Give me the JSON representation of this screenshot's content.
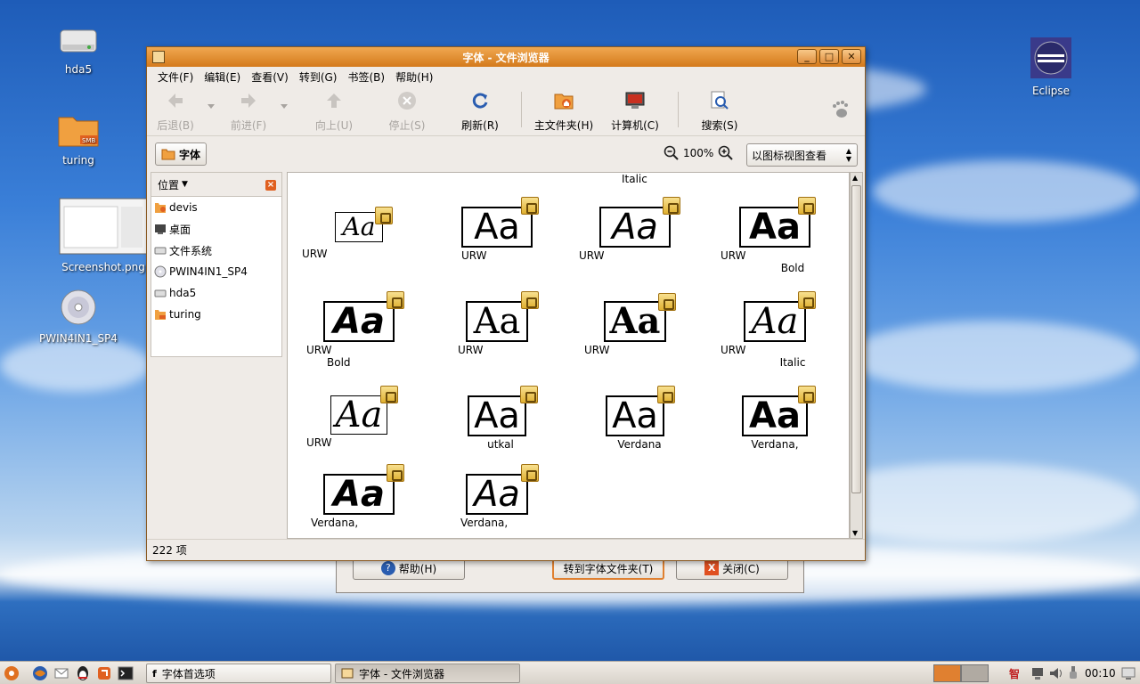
{
  "desktop": {
    "icons": [
      {
        "label": "hda5"
      },
      {
        "label": "turing"
      },
      {
        "label": "Screenshot.png"
      },
      {
        "label": "PWIN4IN1_SP4"
      },
      {
        "label": "Eclipse"
      }
    ]
  },
  "window": {
    "title": "字体 - 文件浏览器",
    "menu": [
      "文件(F)",
      "编辑(E)",
      "查看(V)",
      "转到(G)",
      "书签(B)",
      "帮助(H)"
    ],
    "toolbar": {
      "back": "后退(B)",
      "forward": "前进(F)",
      "up": "向上(U)",
      "stop": "停止(S)",
      "refresh": "刷新(R)",
      "home": "主文件夹(H)",
      "computer": "计算机(C)",
      "search": "搜索(S)"
    },
    "location": {
      "current": "字体",
      "zoom": "100%",
      "view_mode": "以图标视图查看"
    },
    "sidebar": {
      "header": "位置",
      "items": [
        "devis",
        "桌面",
        "文件系统",
        "PWIN4IN1_SP4",
        "hda5",
        "turing"
      ]
    },
    "top_partial_label": "Italic",
    "fonts": [
      {
        "glyph": "Aa",
        "name": "URW",
        "name2": ""
      },
      {
        "glyph": "Aa",
        "name": "URW",
        "name2": ""
      },
      {
        "glyph": "Aa",
        "name": "URW",
        "name2": ""
      },
      {
        "glyph": "Aa",
        "name": "URW",
        "name2": "Bold"
      },
      {
        "glyph": "Aa",
        "name": "URW",
        "name2": "Bold"
      },
      {
        "glyph": "Aa",
        "name": "URW",
        "name2": ""
      },
      {
        "glyph": "Aa",
        "name": "URW",
        "name2": ""
      },
      {
        "glyph": "Aa",
        "name": "URW",
        "name2": "Italic"
      },
      {
        "glyph": "Aa",
        "name": "URW",
        "name2": ""
      },
      {
        "glyph": "Aa",
        "name": "utkal",
        "name2": ""
      },
      {
        "glyph": "Aa",
        "name": "Verdana",
        "name2": ""
      },
      {
        "glyph": "Aa",
        "name": "Verdana,",
        "name2": ""
      },
      {
        "glyph": "Aa",
        "name": "Verdana,",
        "name2": ""
      },
      {
        "glyph": "Aa",
        "name": "Verdana,",
        "name2": ""
      }
    ],
    "status": "222 项"
  },
  "background_dialog": {
    "help": "帮助(H)",
    "goto_fonts": "转到字体文件夹(T)",
    "close": "关闭(C)"
  },
  "taskbar": {
    "tasks": [
      "字体首选项",
      "字体 - 文件浏览器"
    ],
    "clock": "00:10",
    "ime": "智"
  }
}
